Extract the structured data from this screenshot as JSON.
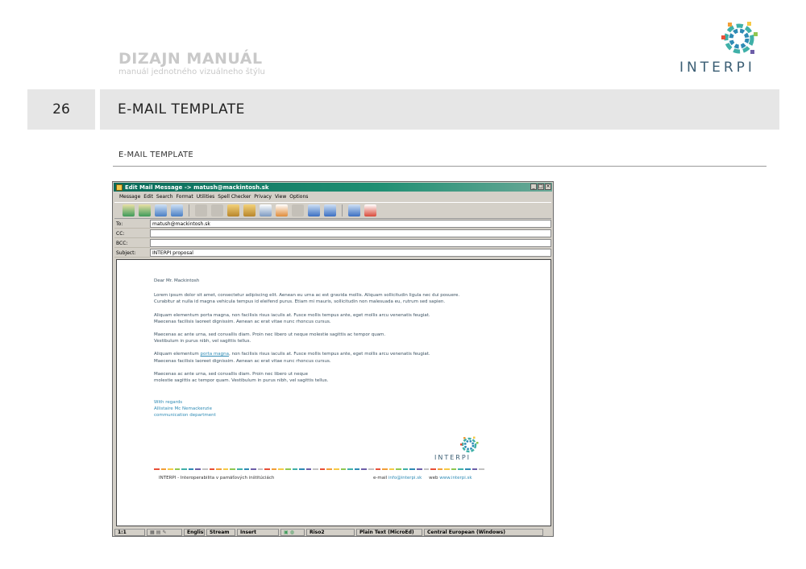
{
  "manual": {
    "title": "DIZAJN MANUÁL",
    "subtitle": "manuál jednotného vizuálneho štýlu"
  },
  "brand": {
    "name": "INTERPI"
  },
  "page": {
    "number": "26",
    "section_title": "E-MAIL TEMPLATE",
    "subheading": "E-MAIL TEMPLATE"
  },
  "window": {
    "title": "Edit Mail Message -> matush@mackintosh.sk",
    "menu": [
      "Message",
      "Edit",
      "Search",
      "Format",
      "Utilities",
      "Spell Checker",
      "Privacy",
      "View",
      "Options"
    ],
    "headers": {
      "to_label": "To:",
      "to_value": "matush@mackintosh.sk",
      "cc_label": "CC:",
      "cc_value": "",
      "bcc_label": "BCC:",
      "bcc_value": "",
      "subject_label": "Subject:",
      "subject_value": "INTERPI proposal"
    },
    "status": {
      "position": "1:1",
      "language": "English",
      "stream": "Stream",
      "mode": "Insert",
      "user": "Riso2",
      "format": "Plain Text (MicroEd)",
      "encoding": "Central European (Windows)"
    }
  },
  "email": {
    "greeting": "Dear Mr. Mackintosh",
    "p1a": "Lorem ipsum dolor sit amet, consectetur adipiscing elit. Aenean eu urna ac est gravida mollis. Aliquam sollicitudin ligula nec dui posuere.",
    "p1b": "Curabitur at nulla id magna vehicula tempus id eleifend purus. Etiam mi mauris, sollicitudin non malesuada eu, rutrum sed sapien.",
    "p2a": "Aliquam elementum porta magna, non facilisis risus iaculis at. Fusce mollis tempus ante, eget mollis arcu venenatis feugiat.",
    "p2b": "Maecenas facilisis laoreet dignissim. Aenean ac erat vitae nunc rhoncus cursus.",
    "p3a": "Maecenas ac ante urna, sed convallis diam. Proin nec libero ut neque  molestie sagittis ac tempor quam.",
    "p3b": "Vestibulum in purus nibh, vel sagittis tellus.",
    "p4_pre": "Aliquam elementum ",
    "p4_link": "porta magna",
    "p4_post": ", non facilisis risus iaculis at. Fusce mollis tempus ante, eget mollis arcu venenatis feugiat.",
    "p4b": "Maecenas facilisis laoreet dignissim. Aenean ac erat vitae nunc rhoncus cursus.",
    "p5a": "Maecenas ac ante urna, sed convallis diam. Proin nec libero ut neque",
    "p5b": "molestie sagittis ac tempor quam. Vestibulum in purus nibh, vel sagittis tellus.",
    "sig1": "With regards",
    "sig2": "Allistaire Mc Nemackenzie",
    "sig3": "communication department",
    "footer_left": "INTERPI - Interoperabilita v pamäťových inštitúciách",
    "footer_email_label": "e-mail",
    "footer_email": "info@interpi.sk",
    "footer_web_label": "web",
    "footer_web": "www.interpi.sk"
  },
  "colors": {
    "accent_blue": "#2e8bb5",
    "brand_text": "#3b5e74",
    "stripe": [
      "#e94f37",
      "#f29e38",
      "#f6c945",
      "#8fc750",
      "#3fb0a8",
      "#2e8bb5",
      "#6d5ea8",
      "#c2c2c2"
    ]
  }
}
